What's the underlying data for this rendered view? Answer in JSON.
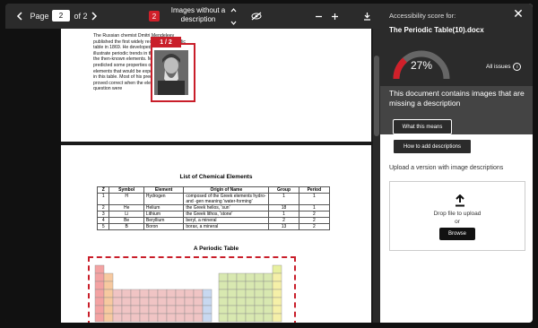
{
  "toolbar": {
    "page_label": "Page",
    "page_current": "2",
    "page_total": "of 2",
    "issue_count": "2",
    "issue_label": "Images without a description"
  },
  "document": {
    "page1_paragraph": "The Russian chemist Dmitri Mendeleev published the first widely recognized periodic table in 1869. He developed his table to illustrate periodic trends in the properties of the then-known elements. Mendeleev also predicted some properties of then-unknown elements that would be expected to fill gaps in this table. Most of his predictions were proved correct when the elements in question were",
    "image_marker": "1 / 2",
    "table_title": "List of Chemical Elements",
    "table_headers": [
      "Z",
      "Symbol",
      "Element",
      "Origin of Name",
      "Group",
      "Period"
    ],
    "table_rows": [
      [
        "1",
        "H",
        "Hydrogen",
        "composed of the Greek elements hydro- and -gen meaning 'water-forming'",
        "1",
        "1"
      ],
      [
        "2",
        "He",
        "Helium",
        "the Greek helios, 'sun'",
        "18",
        "1"
      ],
      [
        "3",
        "Li",
        "Lithium",
        "the Greek lithos, 'stone'",
        "1",
        "2"
      ],
      [
        "4",
        "Be",
        "Beryllium",
        "beryl, a mineral",
        "2",
        "2"
      ],
      [
        "5",
        "B",
        "Boron",
        "borax, a mineral",
        "13",
        "2"
      ]
    ],
    "periodic_title": "A Periodic Table"
  },
  "panel": {
    "score_label": "Accessibility score for:",
    "file_name": "The Periodic Table(10).docx",
    "score_percent": "27%",
    "score_value": 0.27,
    "all_issues": "All issues",
    "warning": "This document contains images that are missing a description",
    "what_this_means": "What this means",
    "how_to_add": "How to add descriptions",
    "upload_label": "Upload a version with image descriptions",
    "drop_text": "Drop file to upload",
    "or_text": "or",
    "browse": "Browse"
  },
  "colors": {
    "accent": "#d0202a",
    "dark": "#2b2b2b"
  }
}
